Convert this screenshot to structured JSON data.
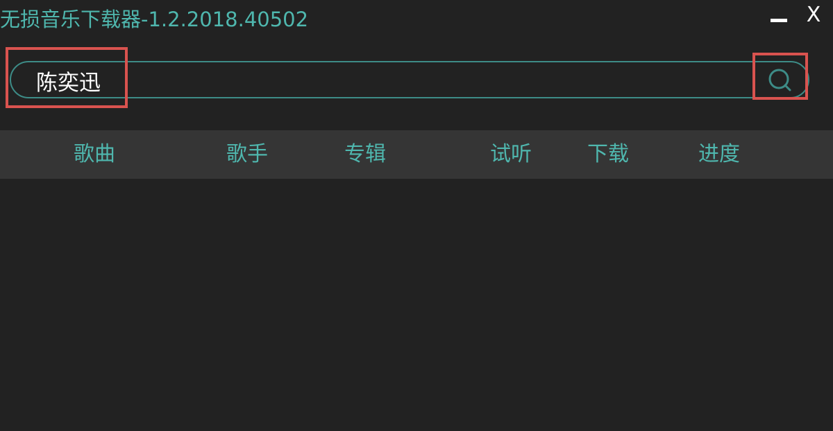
{
  "window": {
    "title": "无损音乐下载器-1.2.2018.40502",
    "minimize_icon": "minimize-icon",
    "close_label": "X"
  },
  "search": {
    "value": "陈奕迅",
    "placeholder": "",
    "icon": "search-icon"
  },
  "table": {
    "columns": [
      "歌曲",
      "歌手",
      "专辑",
      "试听",
      "下载",
      "进度"
    ],
    "rows": []
  },
  "colors": {
    "accent": "#4fb7ae",
    "background": "#222222",
    "header_bg": "#353535",
    "highlight": "#d9534f"
  }
}
